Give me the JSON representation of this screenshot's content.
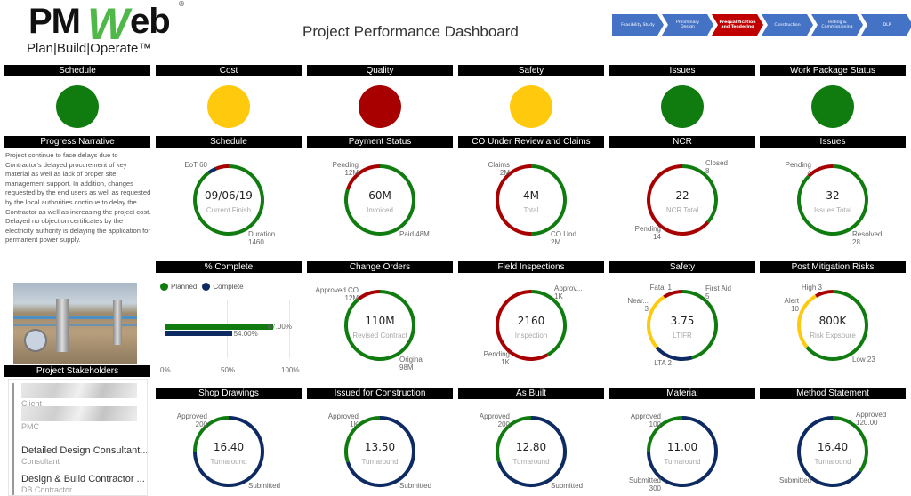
{
  "header": {
    "logo_main": "PM",
    "logo_w": "W",
    "logo_rest": "eb",
    "logo_registered": "®",
    "logo_tagline": "Plan|Build|Operate™",
    "title": "Project Performance Dashboard"
  },
  "phases": [
    {
      "label": "Feasibility Study",
      "active": false
    },
    {
      "label": "Preliminary Design",
      "active": false
    },
    {
      "label": "Prequalification and Tendering",
      "active": true
    },
    {
      "label": "Construction",
      "active": false
    },
    {
      "label": "Testing & Commissioning",
      "active": false
    },
    {
      "label": "DLP",
      "active": false
    }
  ],
  "colors": {
    "green": "#107c10",
    "amber": "#ffc90e",
    "red": "#a80000",
    "navy": "#0d2a63",
    "phase_blue": "#4472c4",
    "phase_active": "#c00000"
  },
  "status_lights": [
    {
      "title": "Schedule",
      "status": "green"
    },
    {
      "title": "Cost",
      "status": "amber"
    },
    {
      "title": "Quality",
      "status": "red"
    },
    {
      "title": "Safety",
      "status": "amber"
    },
    {
      "title": "Issues",
      "status": "green"
    },
    {
      "title": "Work Package Status",
      "status": "green"
    }
  ],
  "narrative": {
    "title": "Progress Narrative",
    "text": "Project continue to face delays due to Contractor's delayed procurement of key material as well as lack of proper site management support. In addition, changes requested by the end users as well as requested by the local authorities continue to delay the Contractor as well as increasing the project cost. Delayed no objection certificates by the electricity authority is delaying the application for permanent power supply."
  },
  "stakeholders": {
    "title": "Project Stakeholders",
    "items": [
      {
        "name": "",
        "role": "Client",
        "redacted": true
      },
      {
        "name": "",
        "role": "PMC",
        "redacted": true
      },
      {
        "name": "Detailed Design Consultant...",
        "role": "Consultant",
        "redacted": false
      },
      {
        "name": "Design & Build Contractor ...",
        "role": "DB Contractor",
        "redacted": false
      }
    ]
  },
  "percent_complete": {
    "title": "% Complete",
    "legend": [
      "Planned",
      "Complete"
    ],
    "axis": [
      "0%",
      "50%",
      "100%"
    ]
  },
  "chart_data": [
    {
      "type": "bar",
      "title": "% Complete",
      "orientation": "horizontal",
      "series": [
        {
          "name": "Planned",
          "values": [
            0.87
          ],
          "label": "87.00%",
          "color": "#107c10"
        },
        {
          "name": "Complete",
          "values": [
            0.54
          ],
          "label": "54.00%",
          "color": "#0d2a63"
        }
      ],
      "xlim": [
        0,
        1
      ],
      "xticks": [
        "0%",
        "50%",
        "100%"
      ],
      "legend": "top-left"
    }
  ],
  "donuts": [
    {
      "id": "schedule",
      "title": "Schedule",
      "value": "09/06/19",
      "sub": "Current Finish",
      "segments": [
        {
          "color": "green",
          "frac": 0.9
        },
        {
          "color": "navy",
          "frac": 0.04
        },
        {
          "color": "red",
          "frac": 0.06
        }
      ],
      "labels": [
        {
          "text": "EoT 60",
          "pos": "tl"
        },
        {
          "text": "Duration\n1460",
          "pos": "br"
        }
      ]
    },
    {
      "id": "payment",
      "title": "Payment Status",
      "value": "60M",
      "sub": "Invoiced",
      "segments": [
        {
          "color": "green",
          "frac": 0.8
        },
        {
          "color": "red",
          "frac": 0.2
        }
      ],
      "labels": [
        {
          "text": "Pending\n12M",
          "pos": "tl"
        },
        {
          "text": "Paid 48M",
          "pos": "br"
        }
      ]
    },
    {
      "id": "co_claims",
      "title": "CO Under Review and Claims",
      "value": "4M",
      "sub": "Total",
      "segments": [
        {
          "color": "green",
          "frac": 0.5
        },
        {
          "color": "red",
          "frac": 0.5
        }
      ],
      "labels": [
        {
          "text": "Claims\n2M",
          "pos": "tl"
        },
        {
          "text": "CO Und...\n2M",
          "pos": "br"
        }
      ]
    },
    {
      "id": "ncr",
      "title": "NCR",
      "value": "22",
      "sub": "NCR Total",
      "segments": [
        {
          "color": "green",
          "frac": 0.3636
        },
        {
          "color": "red",
          "frac": 0.6364
        }
      ],
      "labels": [
        {
          "text": "Closed\n8",
          "pos": "tr"
        },
        {
          "text": "Pending\n14",
          "pos": "bl"
        }
      ]
    },
    {
      "id": "issues",
      "title": "Issues",
      "value": "32",
      "sub": "Issues Total",
      "segments": [
        {
          "color": "green",
          "frac": 0.875
        },
        {
          "color": "red",
          "frac": 0.125
        }
      ],
      "labels": [
        {
          "text": "Pending\n4",
          "pos": "tl"
        },
        {
          "text": "Resolved\n28",
          "pos": "br"
        }
      ]
    },
    {
      "id": "change_orders",
      "title": "Change Orders",
      "value": "110M",
      "sub": "Revised Contract",
      "segments": [
        {
          "color": "green",
          "frac": 0.89
        },
        {
          "color": "red",
          "frac": 0.11
        }
      ],
      "labels": [
        {
          "text": "Approved CO\n12M",
          "pos": "tl"
        },
        {
          "text": "Original\n98M",
          "pos": "br"
        }
      ]
    },
    {
      "id": "field_inspections",
      "title": "Field Inspections",
      "value": "2160",
      "sub": "Inspection",
      "segments": [
        {
          "color": "green",
          "frac": 0.42
        },
        {
          "color": "red",
          "frac": 0.58
        }
      ],
      "labels": [
        {
          "text": "Approv...\n1K",
          "pos": "tr"
        },
        {
          "text": "Pending\n1K",
          "pos": "bl"
        }
      ]
    },
    {
      "id": "safety",
      "title": "Safety",
      "value": "3.75",
      "sub": "LTIFR",
      "segments": [
        {
          "color": "green",
          "frac": 0.4545
        },
        {
          "color": "navy",
          "frac": 0.1818
        },
        {
          "color": "amber",
          "frac": 0.2727
        },
        {
          "color": "red",
          "frac": 0.091
        }
      ],
      "labels": [
        {
          "text": "Fatal 1",
          "pos": "tl2"
        },
        {
          "text": "First Aid\n5",
          "pos": "tr"
        },
        {
          "text": "Near...\n3",
          "pos": "l"
        },
        {
          "text": "LTA 2",
          "pos": "b"
        }
      ]
    },
    {
      "id": "post_mitigation",
      "title": "Post Mitigation Risks",
      "value": "800K",
      "sub": "Risk Expsoure",
      "segments": [
        {
          "color": "green",
          "frac": 0.639
        },
        {
          "color": "amber",
          "frac": 0.278
        },
        {
          "color": "red",
          "frac": 0.083
        }
      ],
      "labels": [
        {
          "text": "High 3",
          "pos": "tl2"
        },
        {
          "text": "Alert\n10",
          "pos": "l"
        },
        {
          "text": "Low 23",
          "pos": "br"
        }
      ]
    },
    {
      "id": "shop_drawings",
      "title": "Shop Drawings",
      "value": "16.40",
      "sub": "Turnaround",
      "segments": [
        {
          "color": "navy",
          "frac": 0.75
        },
        {
          "color": "green",
          "frac": 0.25
        }
      ],
      "labels": [
        {
          "text": "Approved\n200",
          "pos": "tl"
        },
        {
          "text": "Submitted",
          "pos": "br"
        }
      ]
    },
    {
      "id": "ifc",
      "title": "Issued for Construction",
      "value": "13.50",
      "sub": "Turnaround",
      "segments": [
        {
          "color": "navy",
          "frac": 0.7
        },
        {
          "color": "green",
          "frac": 0.3
        }
      ],
      "labels": [
        {
          "text": "Approved\n1K",
          "pos": "tl"
        },
        {
          "text": "Submitted",
          "pos": "br"
        }
      ]
    },
    {
      "id": "as_built",
      "title": "As Built",
      "value": "12.80",
      "sub": "Turnaround",
      "segments": [
        {
          "color": "navy",
          "frac": 0.7
        },
        {
          "color": "green",
          "frac": 0.3
        }
      ],
      "labels": [
        {
          "text": "Approved\n200",
          "pos": "tl"
        },
        {
          "text": "Submitted",
          "pos": "br"
        }
      ]
    },
    {
      "id": "material",
      "title": "Material",
      "value": "11.00",
      "sub": "Turnaround",
      "segments": [
        {
          "color": "navy",
          "frac": 0.75
        },
        {
          "color": "green",
          "frac": 0.25
        }
      ],
      "labels": [
        {
          "text": "Approved\n100",
          "pos": "tl"
        },
        {
          "text": "Submitted\n300",
          "pos": "bl"
        }
      ]
    },
    {
      "id": "method_statement",
      "title": "Method Statement",
      "value": "16.40",
      "sub": "Turnaround",
      "segments": [
        {
          "color": "green",
          "frac": 0.35
        },
        {
          "color": "navy",
          "frac": 0.65
        }
      ],
      "labels": [
        {
          "text": "Approved\n120.00",
          "pos": "tr"
        },
        {
          "text": "Submitted",
          "pos": "bl"
        }
      ]
    }
  ]
}
